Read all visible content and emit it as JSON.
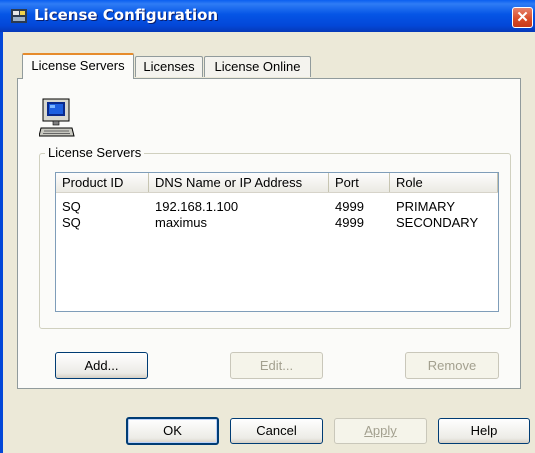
{
  "window": {
    "title": "License Configuration",
    "close_symbol": "✕"
  },
  "tabs": [
    {
      "label": "License Servers",
      "active": true
    },
    {
      "label": "Licenses",
      "active": false
    },
    {
      "label": "License Online",
      "active": false
    }
  ],
  "group": {
    "label": "License Servers",
    "icon": "computer-icon"
  },
  "table": {
    "columns": [
      "Product ID",
      "DNS Name or IP Address",
      "Port",
      "Role"
    ],
    "rows": [
      [
        "SQ",
        "192.168.1.100",
        "4999",
        "PRIMARY"
      ],
      [
        "SQ",
        "maximus",
        "4999",
        "SECONDARY"
      ]
    ]
  },
  "panel_buttons": {
    "add": "Add...",
    "edit": "Edit...",
    "remove": "Remove"
  },
  "dialog_buttons": {
    "ok": "OK",
    "cancel": "Cancel",
    "apply": "Apply",
    "help": "Help"
  },
  "colors": {
    "titlebar": "#0555e6",
    "close": "#d84a25",
    "dialog_bg": "#ece9d8",
    "active_tab_accent": "#e68b2c"
  }
}
